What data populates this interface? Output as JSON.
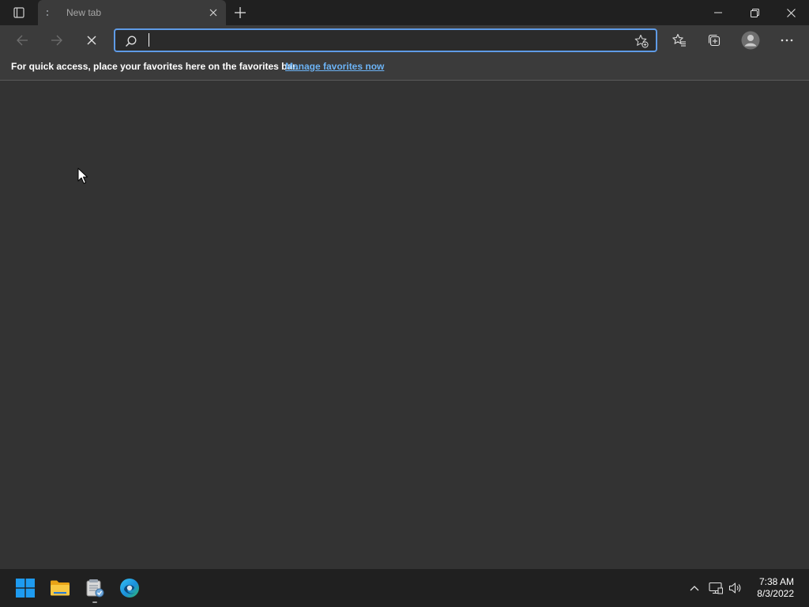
{
  "browser": {
    "tab": {
      "title": "New tab"
    },
    "address_bar": {
      "value": "",
      "placeholder": ""
    },
    "favorites_bar": {
      "message": "For quick access, place your favorites here on the favorites bar.",
      "link": "Manage favorites now"
    }
  },
  "taskbar": {
    "clock": {
      "time": "7:38 AM",
      "date": "8/3/2022"
    }
  },
  "colors": {
    "accent": "#5f9be6",
    "link": "#6cb3f5",
    "page_bg": "#333333",
    "toolbar_bg": "#3b3b3b",
    "titlebar_bg": "#202020"
  },
  "icons": {
    "tab_actions": "tab-actions-icon",
    "tab_loading": "loading-icon",
    "tab_close": "close-icon",
    "new_tab": "plus-icon",
    "minimize": "minimize-icon",
    "restore": "restore-icon",
    "close_window": "close-icon",
    "back": "back-arrow-icon",
    "forward": "forward-arrow-icon",
    "stop": "stop-icon",
    "search": "search-icon",
    "add_favorite": "star-add-icon",
    "favorites": "favorites-icon",
    "collections": "collections-icon",
    "profile": "profile-icon",
    "more": "more-icon",
    "start": "windows-start-icon",
    "file_explorer": "folder-icon",
    "app": "app-icon",
    "edge": "edge-icon",
    "tray_overflow": "chevron-up-icon",
    "network": "network-icon",
    "volume": "volume-icon"
  }
}
